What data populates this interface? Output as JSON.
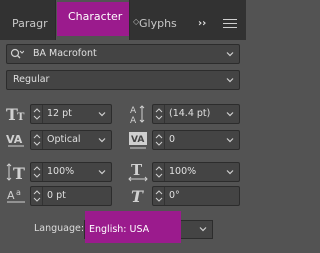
{
  "tabs": [
    {
      "label": "Paragr"
    },
    {
      "label": "Character"
    },
    {
      "label": "Glyphs"
    }
  ],
  "tab_overflow_label": "››",
  "font": {
    "family": "BA Macrofont",
    "style": "Regular"
  },
  "font_size": "12 pt",
  "leading": "(14.4 pt)",
  "kerning": "Optical",
  "tracking": "0",
  "vertical_scale": "100%",
  "horizontal_scale": "100%",
  "baseline_shift": "0 pt",
  "skew": "0°",
  "language": {
    "label": "Language:",
    "value": "English: USA"
  },
  "colors": {
    "panel": "#535353",
    "tabbar": "#323232",
    "highlight": "#9b1b8d"
  }
}
